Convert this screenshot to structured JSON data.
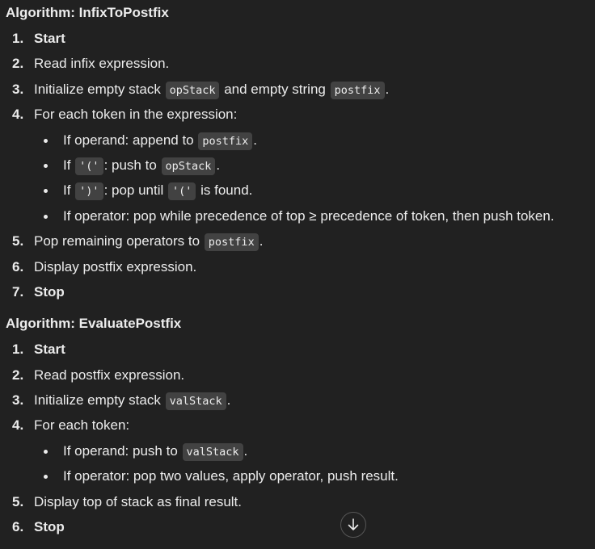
{
  "algo1": {
    "title": "Algorithm: InfixToPostfix",
    "steps": [
      {
        "num": "1.",
        "text": "Start"
      },
      {
        "num": "2.",
        "text": "Read infix expression."
      },
      {
        "num": "3.",
        "pre": "Initialize empty stack ",
        "code1": "opStack",
        "mid": " and empty string ",
        "code2": "postfix",
        "post": "."
      },
      {
        "num": "4.",
        "text": "For each token in the expression:"
      },
      {
        "num": "5.",
        "pre": "Pop remaining operators to ",
        "code": "postfix",
        "post": "."
      },
      {
        "num": "6.",
        "text": "Display postfix expression."
      },
      {
        "num": "7.",
        "text": "Stop"
      }
    ],
    "sub": [
      {
        "pre": "If operand: append to ",
        "code": "postfix",
        "post": "."
      },
      {
        "pre": "If ",
        "code1": "'('",
        "mid": ": push to ",
        "code2": "opStack",
        "post": "."
      },
      {
        "pre": "If ",
        "code1": "')'",
        "mid": ": pop until ",
        "code2": "'('",
        "post": " is found."
      },
      {
        "text": "If operator: pop while precedence of top ≥ precedence of token, then push token."
      }
    ]
  },
  "algo2": {
    "title": "Algorithm: EvaluatePostfix",
    "steps": [
      {
        "num": "1.",
        "text": "Start"
      },
      {
        "num": "2.",
        "text": "Read postfix expression."
      },
      {
        "num": "3.",
        "pre": "Initialize empty stack ",
        "code": "valStack",
        "post": "."
      },
      {
        "num": "4.",
        "text": "For each token:"
      },
      {
        "num": "5.",
        "text": "Display top of stack as final result."
      },
      {
        "num": "6.",
        "text": "Stop"
      }
    ],
    "sub": [
      {
        "pre": "If operand: push to ",
        "code": "valStack",
        "post": "."
      },
      {
        "text": "If operator: pop two values, apply operator, push result."
      }
    ]
  },
  "scroll_button": {
    "icon": "arrow-down-icon",
    "glyph": "↓"
  }
}
